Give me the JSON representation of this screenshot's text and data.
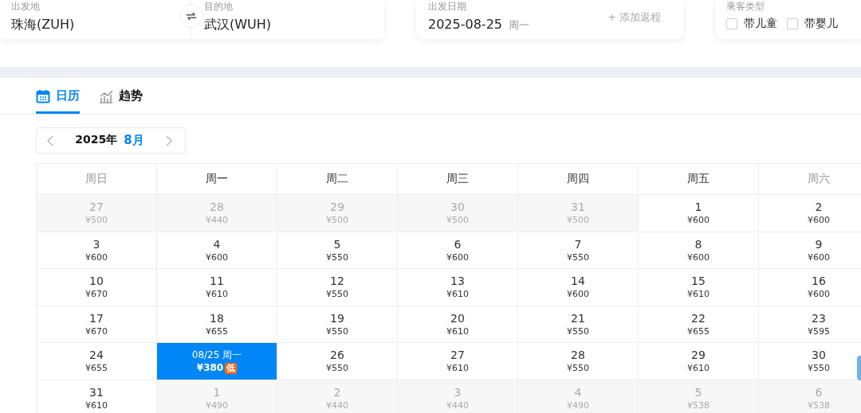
{
  "route": {
    "origin": {
      "label": "出发地",
      "value": "珠海(ZUH)"
    },
    "destination": {
      "label": "目的地",
      "value": "武汉(WUH)"
    }
  },
  "date": {
    "label": "出发日期",
    "value": "2025-08-25",
    "weekday": "周一",
    "return_link": "+ 添加返程"
  },
  "passengers": {
    "label": "乘客类型",
    "options": [
      {
        "label": "带儿童",
        "checked": false
      },
      {
        "label": "带婴儿",
        "checked": false
      }
    ]
  },
  "tabs": [
    {
      "label": "日历",
      "kind": "calendar",
      "selected": true
    },
    {
      "label": "趋势",
      "kind": "trend",
      "selected": false
    }
  ],
  "month_nav": {
    "year": "2025年",
    "month": "8月"
  },
  "calendar": {
    "weekdays": [
      {
        "label": "周日",
        "weekend": true
      },
      {
        "label": "周一",
        "weekend": false
      },
      {
        "label": "周二",
        "weekend": false
      },
      {
        "label": "周三",
        "weekend": false
      },
      {
        "label": "周四",
        "weekend": false
      },
      {
        "label": "周五",
        "weekend": false
      },
      {
        "label": "周六",
        "weekend": true
      }
    ],
    "weeks": [
      [
        {
          "day": "27",
          "price": "¥500",
          "outside": true,
          "selected": false
        },
        {
          "day": "28",
          "price": "¥440",
          "outside": true,
          "selected": false
        },
        {
          "day": "29",
          "price": "¥500",
          "outside": true,
          "selected": false
        },
        {
          "day": "30",
          "price": "¥500",
          "outside": true,
          "selected": false
        },
        {
          "day": "31",
          "price": "¥500",
          "outside": true,
          "selected": false
        },
        {
          "day": "1",
          "price": "¥600",
          "outside": false,
          "selected": false
        },
        {
          "day": "2",
          "price": "¥600",
          "outside": false,
          "selected": false
        }
      ],
      [
        {
          "day": "3",
          "price": "¥600",
          "outside": false,
          "selected": false
        },
        {
          "day": "4",
          "price": "¥600",
          "outside": false,
          "selected": false
        },
        {
          "day": "5",
          "price": "¥550",
          "outside": false,
          "selected": false
        },
        {
          "day": "6",
          "price": "¥600",
          "outside": false,
          "selected": false
        },
        {
          "day": "7",
          "price": "¥550",
          "outside": false,
          "selected": false
        },
        {
          "day": "8",
          "price": "¥600",
          "outside": false,
          "selected": false
        },
        {
          "day": "9",
          "price": "¥600",
          "outside": false,
          "selected": false
        }
      ],
      [
        {
          "day": "10",
          "price": "¥670",
          "outside": false,
          "selected": false
        },
        {
          "day": "11",
          "price": "¥610",
          "outside": false,
          "selected": false
        },
        {
          "day": "12",
          "price": "¥550",
          "outside": false,
          "selected": false
        },
        {
          "day": "13",
          "price": "¥610",
          "outside": false,
          "selected": false
        },
        {
          "day": "14",
          "price": "¥600",
          "outside": false,
          "selected": false
        },
        {
          "day": "15",
          "price": "¥610",
          "outside": false,
          "selected": false
        },
        {
          "day": "16",
          "price": "¥600",
          "outside": false,
          "selected": false
        }
      ],
      [
        {
          "day": "17",
          "price": "¥670",
          "outside": false,
          "selected": false
        },
        {
          "day": "18",
          "price": "¥655",
          "outside": false,
          "selected": false
        },
        {
          "day": "19",
          "price": "¥550",
          "outside": false,
          "selected": false
        },
        {
          "day": "20",
          "price": "¥610",
          "outside": false,
          "selected": false
        },
        {
          "day": "21",
          "price": "¥550",
          "outside": false,
          "selected": false
        },
        {
          "day": "22",
          "price": "¥655",
          "outside": false,
          "selected": false
        },
        {
          "day": "23",
          "price": "¥595",
          "outside": false,
          "selected": false
        }
      ],
      [
        {
          "day": "24",
          "price": "¥655",
          "outside": false,
          "selected": false
        },
        {
          "day": "08/25 周一",
          "price": "¥380",
          "badge": "低",
          "outside": false,
          "selected": true
        },
        {
          "day": "26",
          "price": "¥550",
          "outside": false,
          "selected": false
        },
        {
          "day": "27",
          "price": "¥610",
          "outside": false,
          "selected": false
        },
        {
          "day": "28",
          "price": "¥550",
          "outside": false,
          "selected": false
        },
        {
          "day": "29",
          "price": "¥610",
          "outside": false,
          "selected": false
        },
        {
          "day": "30",
          "price": "¥550",
          "outside": false,
          "selected": false
        }
      ],
      [
        {
          "day": "31",
          "price": "¥610",
          "outside": false,
          "selected": false
        },
        {
          "day": "1",
          "price": "¥490",
          "outside": true,
          "selected": false
        },
        {
          "day": "2",
          "price": "¥440",
          "outside": true,
          "selected": false
        },
        {
          "day": "3",
          "price": "¥440",
          "outside": true,
          "selected": false
        },
        {
          "day": "4",
          "price": "¥490",
          "outside": true,
          "selected": false
        },
        {
          "day": "5",
          "price": "¥538",
          "outside": true,
          "selected": false
        },
        {
          "day": "6",
          "price": "¥538",
          "outside": true,
          "selected": false
        }
      ]
    ]
  }
}
